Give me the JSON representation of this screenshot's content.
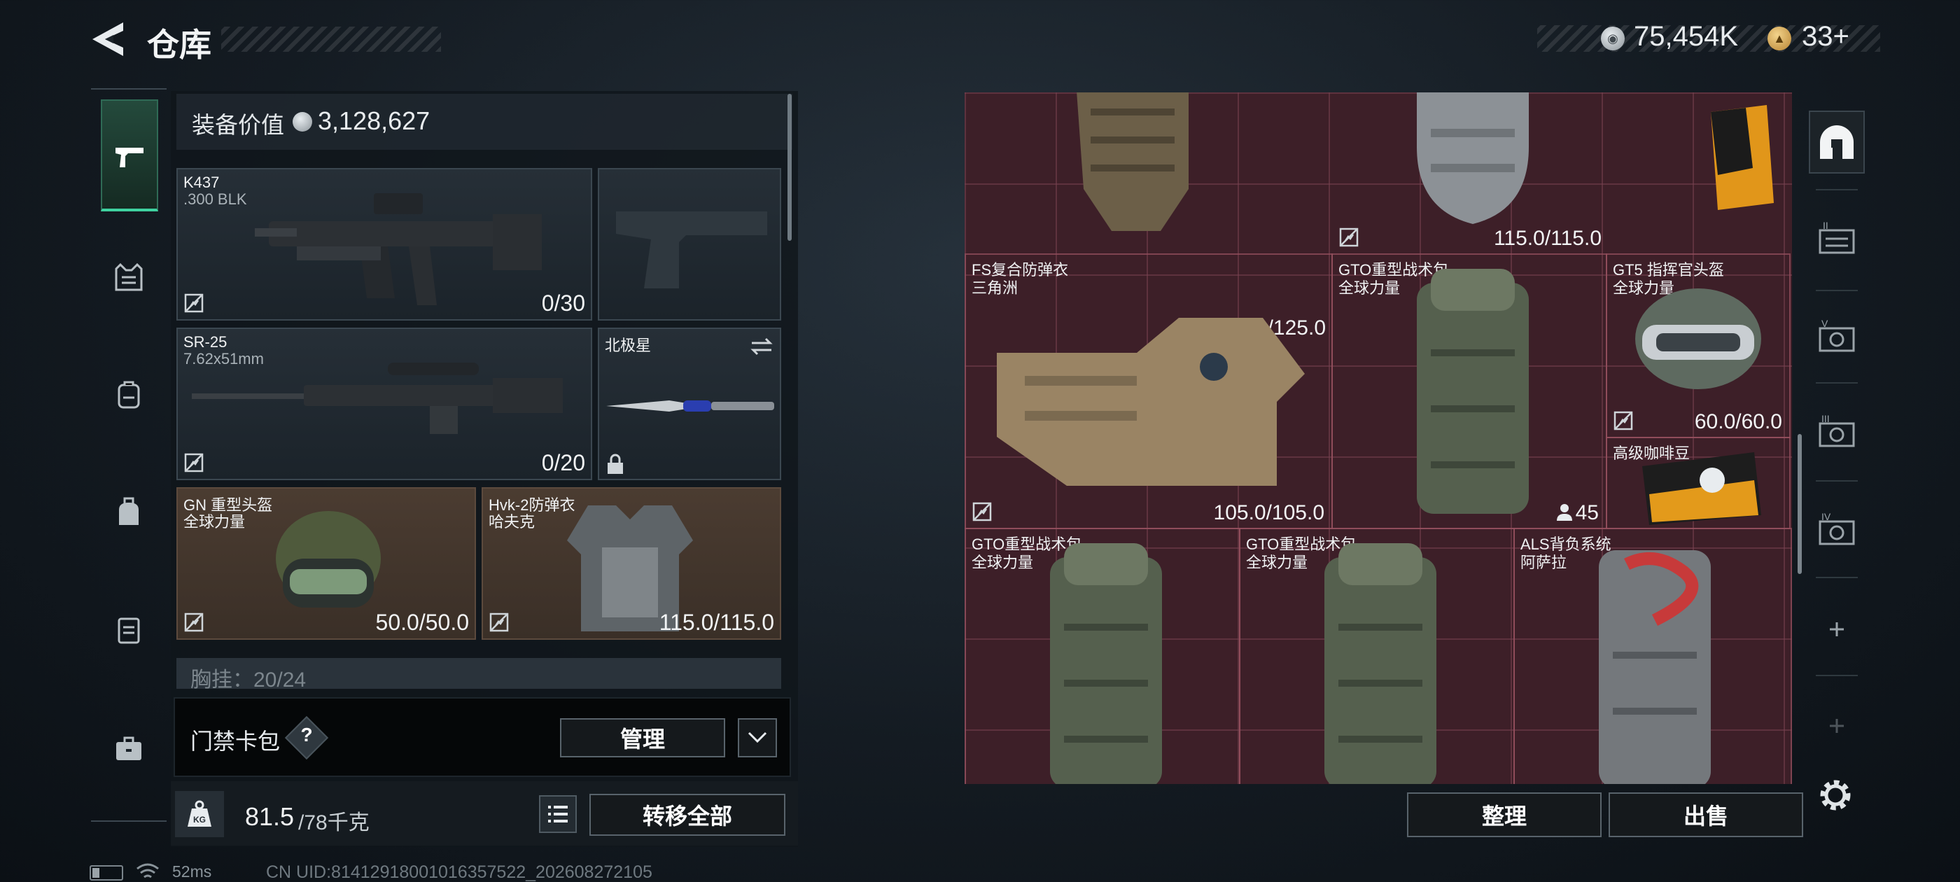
{
  "header": {
    "title": "仓库",
    "silver_value": "75,454K",
    "gold_value": "33+"
  },
  "sidebar": {
    "categories": [
      {
        "icon": "pistol-icon",
        "active": true
      },
      {
        "icon": "vest-icon"
      },
      {
        "icon": "backpack-small-icon"
      },
      {
        "icon": "bag-icon"
      },
      {
        "icon": "clipboard-icon"
      },
      {
        "icon": "briefcase-icon"
      }
    ]
  },
  "equipment": {
    "label": "装备价值",
    "value": "3,128,627",
    "slots": [
      {
        "name": "K437",
        "sub": ".300 BLK",
        "count": "0/30"
      },
      {
        "name": "",
        "sub": "",
        "count": ""
      },
      {
        "name": "SR-25",
        "sub": "7.62x51mm",
        "count": "0/20"
      },
      {
        "name": "北极星",
        "sub": "",
        "count": ""
      },
      {
        "name": "GN 重型头盔",
        "sub": "全球力量",
        "count": "50.0/50.0"
      },
      {
        "name": "Hvk-2防弹衣",
        "sub": "哈夫克",
        "count": "115.0/115.0"
      }
    ],
    "chest_label": "胸挂：20/24"
  },
  "access_card": {
    "label": "门禁卡包",
    "help": "?",
    "manage": "管理"
  },
  "weight": {
    "current": "81.5",
    "max": "/78千克",
    "transfer": "转移全部"
  },
  "storage": {
    "items": [
      {
        "name": "",
        "sub": "",
        "durability": "106.0/125.0"
      },
      {
        "name": "",
        "sub": "",
        "durability": "115.0/115.0"
      },
      {
        "name": "FS复合防弹衣",
        "sub": "三角洲",
        "durability": "105.0/105.0"
      },
      {
        "name": "GTO重型战术包",
        "sub": "全球力量",
        "qty": "45"
      },
      {
        "name": "GT5 指挥官头盔",
        "sub": "全球力量",
        "durability": "60.0/60.0"
      },
      {
        "name": "高级咖啡豆",
        "sub": ""
      },
      {
        "name": "GTO重型战术包",
        "sub": "全球力量"
      },
      {
        "name": "GTO重型战术包",
        "sub": "全球力量"
      },
      {
        "name": "ALS背负系统",
        "sub": "阿萨拉"
      }
    ],
    "tidy": "整理",
    "sell": "出售",
    "tabs": [
      "home-icon",
      "tier-1-icon",
      "tier-v-icon",
      "tier-3-icon",
      "tier-4-icon",
      "add-icon",
      "add-icon"
    ]
  },
  "status": {
    "ping": "52ms",
    "uid": "CN UID:81412918001016357522_202608272105"
  },
  "colors": {
    "accent_green": "#3fd2a0",
    "storage_red": "#3d1f28",
    "gold": "#d6a74c"
  }
}
